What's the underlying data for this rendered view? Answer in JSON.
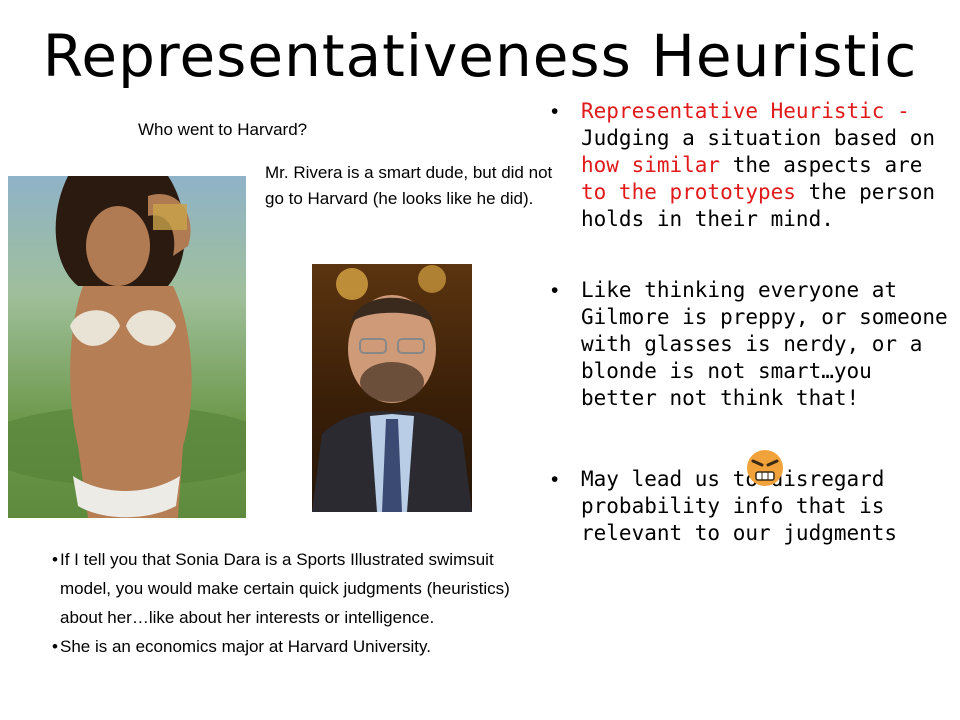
{
  "slide": {
    "title": "Representativeness Heuristic",
    "question": "Who went to Harvard?",
    "rivera_note": "Mr. Rivera is a smart dude, but did not go to Harvard (he looks like he did).",
    "bullet_char": "•",
    "right_bullets": [
      {
        "term": "Representative Heuristic -",
        "text_1": " Judging a situation based on ",
        "highlight_1": "how similar",
        "text_2": " the aspects are ",
        "highlight_2": "to the prototypes",
        "text_3": " the person holds in their mind."
      },
      {
        "text": "Like thinking everyone at Gilmore is preppy, or someone with glasses is nerdy, or a blonde is not smart…you better not think that!"
      },
      {
        "text": "May lead us to disregard probability info that is relevant to our judgments"
      }
    ],
    "bottom_bullets": [
      "If I tell you that Sonia Dara is a Sports Illustrated swimsuit model, you would make certain quick judgments (heuristics) about her…like about her interests or intelligence.",
      "She is an economics major at Harvard University."
    ],
    "icons": {
      "angry_face": "angry-face-icon"
    },
    "colors": {
      "highlight": "#e0191a",
      "text": "#000000",
      "background": "#ffffff"
    }
  }
}
